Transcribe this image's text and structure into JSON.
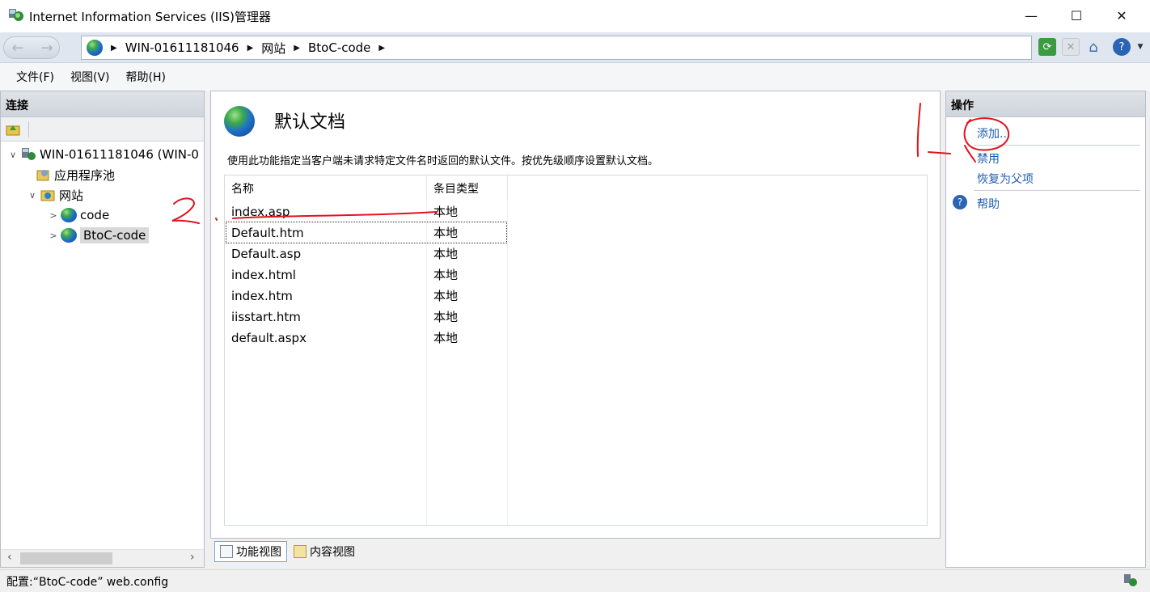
{
  "window": {
    "title": "Internet Information Services (IIS)管理器",
    "minimize": "—",
    "maximize": "☐",
    "close": "✕"
  },
  "address": {
    "crumbs": [
      "WIN-01611181046",
      "网站",
      "BtoC-code"
    ],
    "arrow": "▶"
  },
  "menu": [
    "文件(F)",
    "视图(V)",
    "帮助(H)"
  ],
  "connections": {
    "header": "连接",
    "tree": [
      {
        "label": "WIN-01611181046 (WIN-0",
        "expander": "∨"
      },
      {
        "label": "应用程序池",
        "expander": ""
      },
      {
        "label": "网站",
        "expander": "∨"
      },
      {
        "label": "code",
        "expander": ">"
      },
      {
        "label": "BtoC-code",
        "expander": ">"
      }
    ]
  },
  "feature": {
    "title": "默认文档",
    "description": "使用此功能指定当客户端未请求特定文件名时返回的默认文件。按优先级顺序设置默认文档。",
    "columns": [
      "名称",
      "条目类型"
    ],
    "rows": [
      {
        "name": "index.asp",
        "type": "本地"
      },
      {
        "name": "Default.htm",
        "type": "本地"
      },
      {
        "name": "Default.asp",
        "type": "本地"
      },
      {
        "name": "index.html",
        "type": "本地"
      },
      {
        "name": "index.htm",
        "type": "本地"
      },
      {
        "name": "iisstart.htm",
        "type": "本地"
      },
      {
        "name": "default.aspx",
        "type": "本地"
      }
    ]
  },
  "view_tabs": [
    "功能视图",
    "内容视图"
  ],
  "actions": {
    "header": "操作",
    "add": "添加...",
    "disable": "禁用",
    "revert": "恢复为父项",
    "help": "帮助"
  },
  "status": "配置:“BtoC-code” web.config",
  "annotations": {
    "marker_1": "1",
    "marker_2": "2"
  },
  "colors": {
    "link": "#1f5fb0",
    "annotation_red": "#e0141e"
  }
}
